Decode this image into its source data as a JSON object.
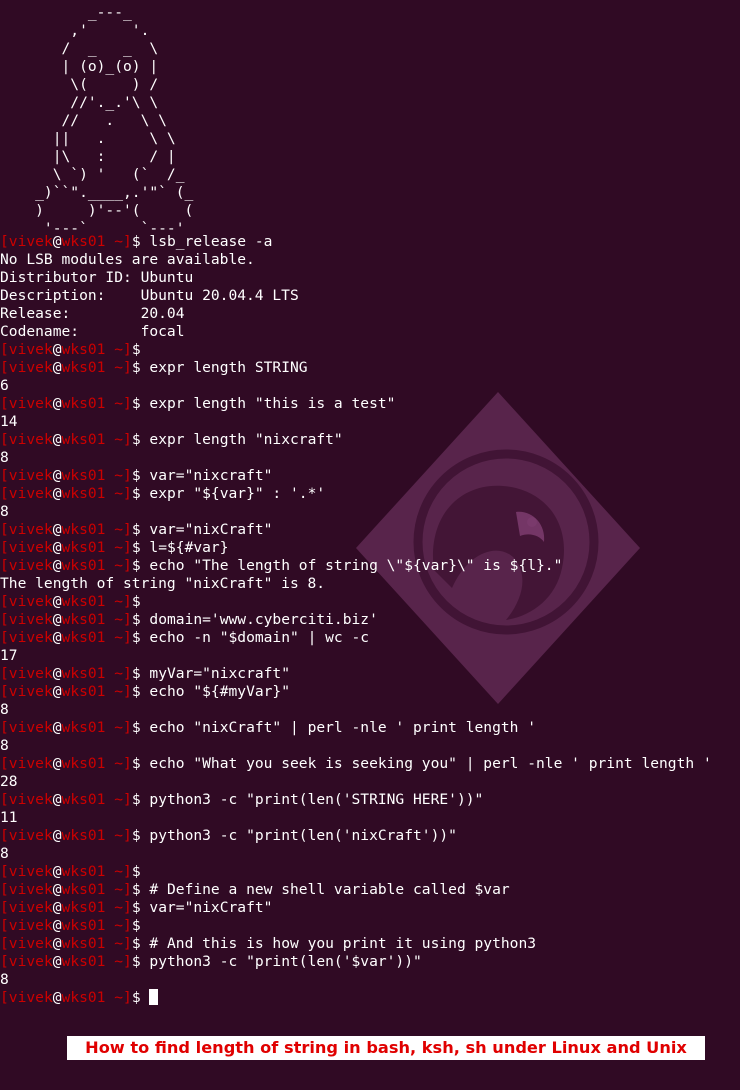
{
  "colors": {
    "background": "#300a24",
    "text": "#ffffff",
    "prompt_red": "#cc0000",
    "caption_text": "#e00000",
    "caption_background": "#ffffff",
    "watermark": "#7a3a6c"
  },
  "watermark_icon": "penguin-logo-icon",
  "ascii_art": [
    "          _---_",
    "        ,'     '.",
    "       /  _   _  \\",
    "       | (o)_(o) |",
    "        \\(     ) /",
    "        //'._.'\\ \\",
    "       //   .   \\ \\",
    "      ||   .     \\ \\",
    "      |\\   :     / |",
    "      \\ `) '   (`  /_",
    "    _)``\".____,.'\"` (_",
    "    )     )'--'(     (",
    "     '---`      `---'"
  ],
  "prompt": {
    "open": "[",
    "user": "vivek",
    "at": "@",
    "host": "wks01",
    "dir": " ~",
    "close": "]",
    "dollar": "$ "
  },
  "lines": [
    {
      "type": "prompt",
      "cmd": "lsb_release -a"
    },
    {
      "type": "out",
      "text": "No LSB modules are available."
    },
    {
      "type": "out",
      "text": "Distributor ID: Ubuntu"
    },
    {
      "type": "out",
      "text": "Description:    Ubuntu 20.04.4 LTS"
    },
    {
      "type": "out",
      "text": "Release:        20.04"
    },
    {
      "type": "out",
      "text": "Codename:       focal"
    },
    {
      "type": "prompt",
      "cmd": ""
    },
    {
      "type": "prompt",
      "cmd": "expr length STRING"
    },
    {
      "type": "out",
      "text": "6"
    },
    {
      "type": "prompt",
      "cmd": "expr length \"this is a test\""
    },
    {
      "type": "out",
      "text": "14"
    },
    {
      "type": "prompt",
      "cmd": "expr length \"nixcraft\""
    },
    {
      "type": "out",
      "text": "8"
    },
    {
      "type": "prompt",
      "cmd": "var=\"nixcraft\""
    },
    {
      "type": "prompt",
      "cmd": "expr \"${var}\" : '.*'"
    },
    {
      "type": "out",
      "text": "8"
    },
    {
      "type": "prompt",
      "cmd": "var=\"nixCraft\""
    },
    {
      "type": "prompt",
      "cmd": "l=${#var}"
    },
    {
      "type": "prompt",
      "cmd": "echo \"The length of string \\\"${var}\\\" is ${l}.\""
    },
    {
      "type": "out",
      "text": "The length of string \"nixCraft\" is 8."
    },
    {
      "type": "prompt",
      "cmd": ""
    },
    {
      "type": "prompt",
      "cmd": "domain='www.cyberciti.biz'"
    },
    {
      "type": "prompt",
      "cmd": "echo -n \"$domain\" | wc -c"
    },
    {
      "type": "out",
      "text": "17"
    },
    {
      "type": "prompt",
      "cmd": "myVar=\"nixcraft\""
    },
    {
      "type": "prompt",
      "cmd": "echo \"${#myVar}\""
    },
    {
      "type": "out",
      "text": "8"
    },
    {
      "type": "prompt",
      "cmd": "echo \"nixCraft\" | perl -nle ' print length '"
    },
    {
      "type": "out",
      "text": "8"
    },
    {
      "type": "prompt",
      "cmd": "echo \"What you seek is seeking you\" | perl -nle ' print length '"
    },
    {
      "type": "out",
      "text": "28"
    },
    {
      "type": "prompt",
      "cmd": "python3 -c \"print(len('STRING HERE'))\""
    },
    {
      "type": "out",
      "text": "11"
    },
    {
      "type": "prompt",
      "cmd": "python3 -c \"print(len('nixCraft'))\""
    },
    {
      "type": "out",
      "text": "8"
    },
    {
      "type": "prompt",
      "cmd": ""
    },
    {
      "type": "prompt",
      "cmd": "# Define a new shell variable called $var"
    },
    {
      "type": "prompt",
      "cmd": "var=\"nixCraft\""
    },
    {
      "type": "prompt",
      "cmd": ""
    },
    {
      "type": "prompt",
      "cmd": "# And this is how you print it using python3"
    },
    {
      "type": "prompt",
      "cmd": "python3 -c \"print(len('$var'))\""
    },
    {
      "type": "out",
      "text": "8"
    },
    {
      "type": "prompt",
      "cmd": "",
      "cursor": true
    }
  ],
  "caption": "How to find length of string in bash, ksh, sh under Linux and Unix"
}
